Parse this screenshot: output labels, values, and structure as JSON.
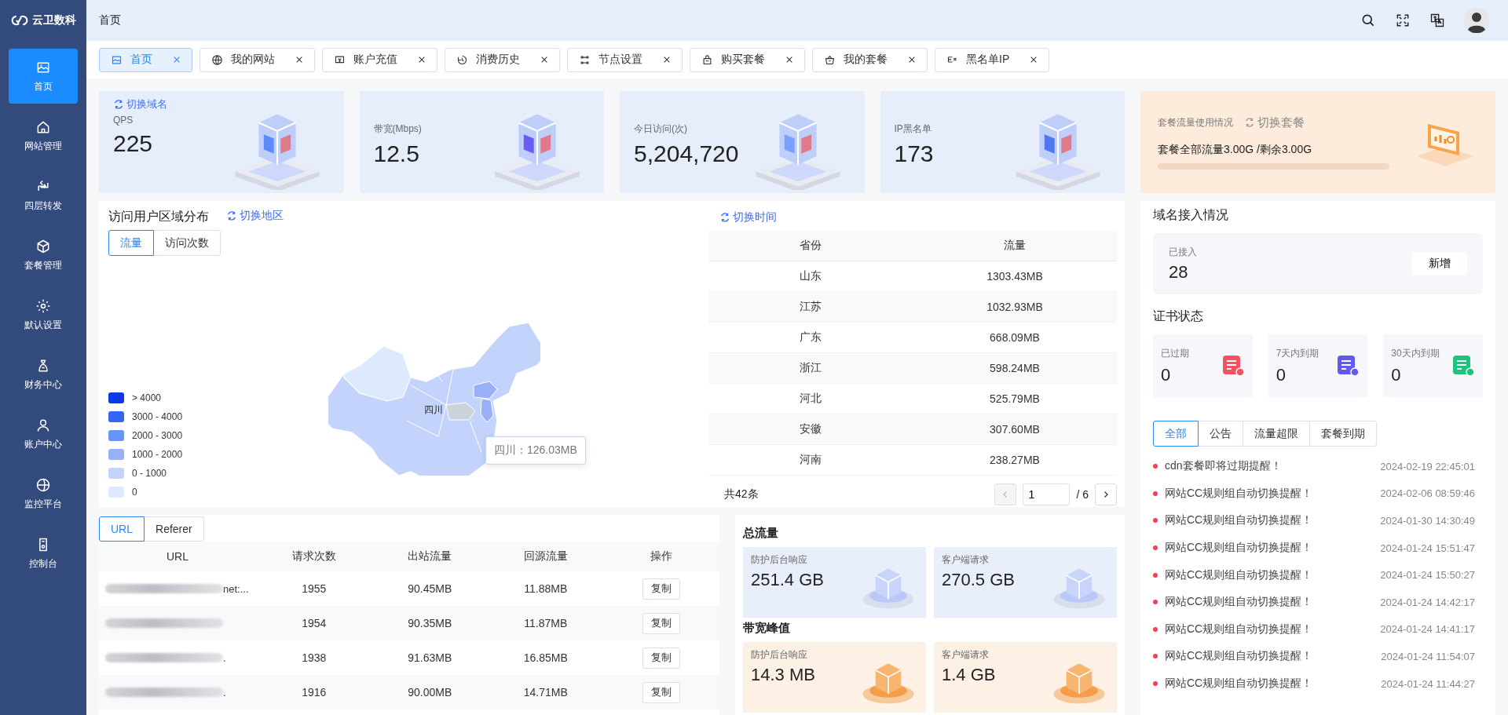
{
  "sidebar": {
    "logo": "云卫数科",
    "items": [
      {
        "label": "首页",
        "selected": true
      },
      {
        "label": "网站管理",
        "selected": false
      },
      {
        "label": "四层转发",
        "selected": false
      },
      {
        "label": "套餐管理",
        "selected": false
      },
      {
        "label": "默认设置",
        "selected": false
      },
      {
        "label": "财务中心",
        "selected": false
      },
      {
        "label": "账户中心",
        "selected": false
      },
      {
        "label": "监控平台",
        "selected": false
      },
      {
        "label": "控制台",
        "selected": false
      }
    ]
  },
  "header": {
    "breadcrumb": "首页"
  },
  "tabs": [
    {
      "label": "首页",
      "selected": true
    },
    {
      "label": "我的网站",
      "selected": false
    },
    {
      "label": "账户充值",
      "selected": false
    },
    {
      "label": "消费历史",
      "selected": false
    },
    {
      "label": "节点设置",
      "selected": false
    },
    {
      "label": "购买套餐",
      "selected": false
    },
    {
      "label": "我的套餐",
      "selected": false
    },
    {
      "label": "黑名单IP",
      "selected": false
    }
  ],
  "stats": [
    {
      "link": "切换域名",
      "label": "QPS",
      "value": "225"
    },
    {
      "label": "带宽(Mbps)",
      "value": "12.5"
    },
    {
      "label": "今日访问(次)",
      "value": "5,204,720"
    },
    {
      "label": "IP黑名单",
      "value": "173"
    }
  ],
  "plan": {
    "title": "套餐流量使用情况",
    "link": "切换套餐",
    "usage": "套餐全部流量3.00G /剩余3.00G",
    "level": 0
  },
  "region": {
    "title": "访问用户区域分布",
    "link": "切换地区",
    "modes": [
      {
        "label": "流量",
        "selected": true
      },
      {
        "label": "访问次数",
        "selected": false
      }
    ],
    "legend": [
      {
        "label": "> 4000",
        "color": "#0b3ae6"
      },
      {
        "label": "3000 - 4000",
        "color": "#3466f2"
      },
      {
        "label": "2000 - 3000",
        "color": "#6596f7"
      },
      {
        "label": "1000 - 2000",
        "color": "#97b0f8"
      },
      {
        "label": "0 - 1000",
        "color": "#c3d3fb"
      },
      {
        "label": "0",
        "color": "#dde9fc"
      }
    ],
    "map_label": "四川",
    "tooltip": "四川：126.03MB"
  },
  "province_table": {
    "link": "切换时间",
    "columns": [
      "省份",
      "流量"
    ],
    "rows": [
      [
        "山东",
        "1303.43MB"
      ],
      [
        "江苏",
        "1032.93MB"
      ],
      [
        "广东",
        "668.09MB"
      ],
      [
        "浙江",
        "598.24MB"
      ],
      [
        "河北",
        "525.79MB"
      ],
      [
        "安徽",
        "307.60MB"
      ],
      [
        "河南",
        "238.27MB"
      ]
    ],
    "total": "共42条",
    "page": "1",
    "pages": "/ 6"
  },
  "url_table": {
    "tabs": [
      {
        "label": "URL",
        "selected": true
      },
      {
        "label": "Referer",
        "selected": false
      }
    ],
    "columns": [
      "URL",
      "请求次数",
      "出站流量",
      "回源流量",
      "操作"
    ],
    "rows": [
      {
        "url_tail": "net:...",
        "requests": "1955",
        "outbound": "90.45MB",
        "origin": "11.88MB",
        "action": "复制"
      },
      {
        "requests": "1954",
        "outbound": "90.35MB",
        "origin": "11.87MB",
        "action": "复制"
      },
      {
        "url_tail": ".",
        "requests": "1938",
        "outbound": "91.63MB",
        "origin": "16.85MB",
        "action": "复制"
      },
      {
        "url_tail": ".",
        "requests": "1916",
        "outbound": "90.00MB",
        "origin": "14.71MB",
        "action": "复制"
      }
    ]
  },
  "traffic": [
    {
      "title": "总流量",
      "kind": "blue",
      "cards": [
        {
          "label": "防护后台响应",
          "value": "251.4 GB"
        },
        {
          "label": "客户端请求",
          "value": "270.5 GB"
        }
      ]
    },
    {
      "title": "带宽峰值",
      "kind": "orange",
      "cards": [
        {
          "label": "防护后台响应",
          "value": "14.3 MB"
        },
        {
          "label": "客户端请求",
          "value": "1.4 GB"
        }
      ]
    }
  ],
  "domains": {
    "title": "域名接入情况",
    "label": "已接入",
    "value": "28",
    "button": "新增"
  },
  "certs": {
    "title": "证书状态",
    "items": [
      {
        "label": "已过期",
        "value": "0",
        "color": "#f5525f"
      },
      {
        "label": "7天内到期",
        "value": "0",
        "color": "#6159f0"
      },
      {
        "label": "30天内到期",
        "value": "0",
        "color": "#1dc47e"
      }
    ]
  },
  "notices": {
    "tabs": [
      {
        "label": "全部",
        "selected": true
      },
      {
        "label": "公告",
        "selected": false
      },
      {
        "label": "流量超限",
        "selected": false
      },
      {
        "label": "套餐到期",
        "selected": false
      }
    ],
    "items": [
      {
        "title": "cdn套餐即将过期提醒！",
        "time": "2024-02-19 22:45:01"
      },
      {
        "title": "网站CC规则组自动切换提醒！",
        "time": "2024-02-06 08:59:46"
      },
      {
        "title": "网站CC规则组自动切换提醒！",
        "time": "2024-01-30 14:30:49"
      },
      {
        "title": "网站CC规则组自动切换提醒！",
        "time": "2024-01-24 15:51:47"
      },
      {
        "title": "网站CC规则组自动切换提醒！",
        "time": "2024-01-24 15:50:27"
      },
      {
        "title": "网站CC规则组自动切换提醒！",
        "time": "2024-01-24 14:42:17"
      },
      {
        "title": "网站CC规则组自动切换提醒！",
        "time": "2024-01-24 14:41:17"
      },
      {
        "title": "网站CC规则组自动切换提醒！",
        "time": "2024-01-24 11:54:07"
      },
      {
        "title": "网站CC规则组自动切换提醒！",
        "time": "2024-01-24 11:44:27"
      }
    ]
  }
}
